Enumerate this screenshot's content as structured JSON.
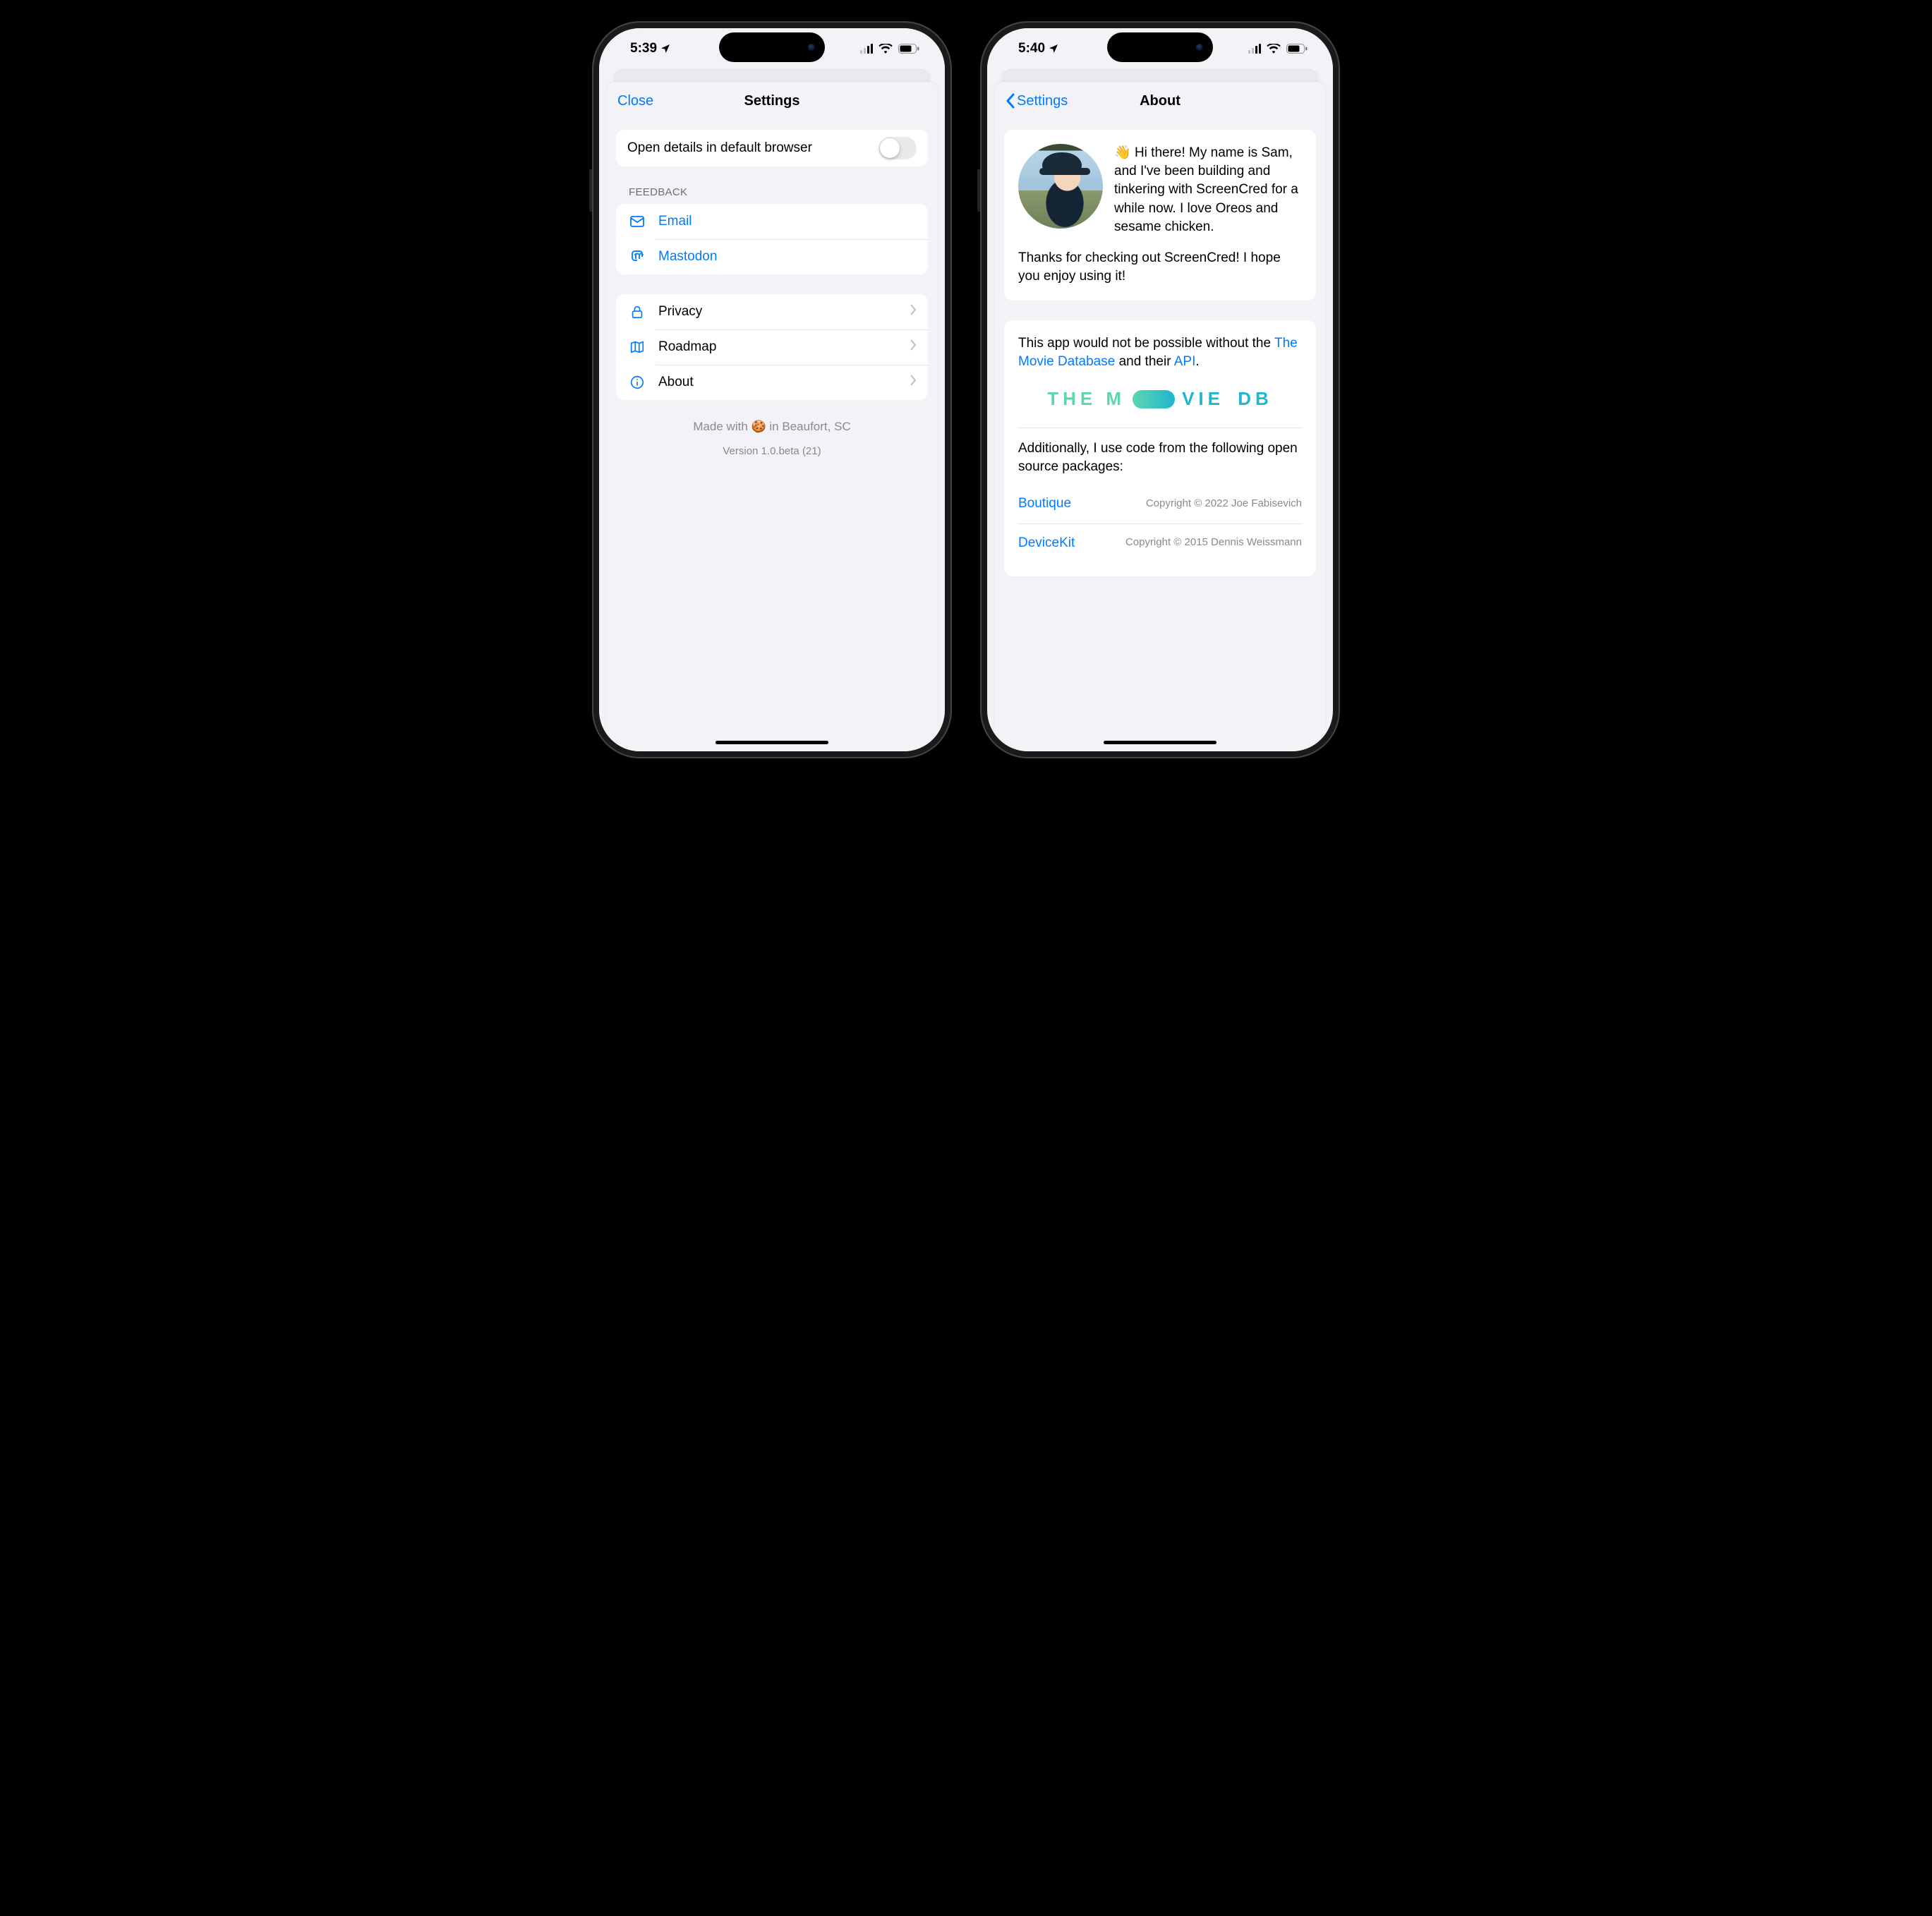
{
  "left": {
    "status_time": "5:39",
    "nav": {
      "close_label": "Close",
      "title": "Settings"
    },
    "toggle": {
      "label": "Open details in default browser",
      "on": false
    },
    "feedback": {
      "header": "FEEDBACK",
      "items": [
        {
          "name": "email",
          "icon": "envelope-icon",
          "label": "Email"
        },
        {
          "name": "mastodon",
          "icon": "mastodon-icon",
          "label": "Mastodon"
        }
      ]
    },
    "more": {
      "items": [
        {
          "name": "privacy",
          "icon": "lock-icon",
          "label": "Privacy"
        },
        {
          "name": "roadmap",
          "icon": "map-icon",
          "label": "Roadmap"
        },
        {
          "name": "about",
          "icon": "info-icon",
          "label": "About"
        }
      ]
    },
    "footer": {
      "made": "Made with 🍪 in Beaufort, SC",
      "version": "Version 1.0.beta (21)"
    }
  },
  "right": {
    "status_time": "5:40",
    "nav": {
      "back_label": "Settings",
      "title": "About"
    },
    "intro": {
      "wave": "👋",
      "greeting": " Hi there! My name is Sam, and I've been building and tinkering with ScreenCred for a while now. I love Oreos and sesame chicken.",
      "thanks": "Thanks for checking out ScreenCred! I hope you enjoy using it!"
    },
    "credits": {
      "pre": "This app would not be possible without the ",
      "tmdb_link": "The Movie Database",
      "mid": " and their ",
      "api_link": "API",
      "post": "."
    },
    "tmdb_logo": {
      "left": "THE M",
      "right_a": "VIE",
      "right_b": "DB"
    },
    "oss": {
      "pre": "Additionally, I use code from the following open source packages:",
      "items": [
        {
          "name": "Boutique",
          "copyright": "Copyright © 2022 Joe Fabisevich"
        },
        {
          "name": "DeviceKit",
          "copyright": "Copyright © 2015 Dennis Weissmann"
        }
      ]
    }
  }
}
